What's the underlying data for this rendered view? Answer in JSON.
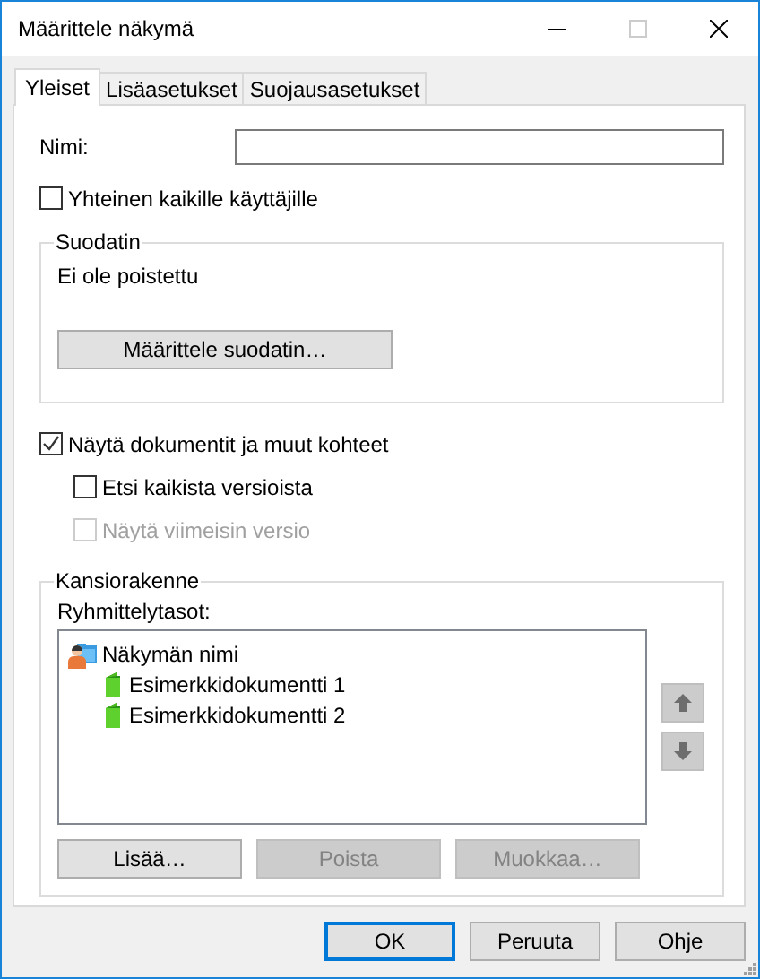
{
  "window": {
    "title": "Määrittele näkymä",
    "controls": [
      {
        "kind": "minimize",
        "disabled": false
      },
      {
        "kind": "maximize",
        "disabled": true
      },
      {
        "kind": "close",
        "disabled": false
      }
    ]
  },
  "tabs": [
    {
      "label": "Yleiset",
      "selected": true
    },
    {
      "label": "Lisäasetukset",
      "selected": false
    },
    {
      "label": "Suojausasetukset",
      "selected": false
    }
  ],
  "name_field": {
    "label": "Nimi:"
  },
  "shared_checkbox": {
    "label": "Yhteinen kaikille käyttäjille",
    "checked": false,
    "disabled": false
  },
  "filter_group": {
    "title": "Suodatin",
    "status": "Ei ole poistettu",
    "button": "Määrittele suodatin…"
  },
  "document_options": [
    {
      "label": "Näytä dokumentit ja muut kohteet",
      "checked": true,
      "disabled": false,
      "children": [
        {
          "label": "Etsi kaikista versioista",
          "checked": false,
          "disabled": false
        },
        {
          "label": "Näytä viimeisin versio",
          "checked": false,
          "disabled": true
        }
      ]
    }
  ],
  "folder_group": {
    "title": "Kansiorakenne",
    "list_label": "Ryhmittelytasot:",
    "tree": [
      {
        "label": "Näkymän nimi",
        "kind": "view",
        "children": [
          {
            "label": "Esimerkkidokumentti 1",
            "kind": "document"
          },
          {
            "label": "Esimerkkidokumentti 2",
            "kind": "document"
          }
        ]
      }
    ],
    "move_buttons": [
      {
        "kind": "up",
        "disabled": true
      },
      {
        "kind": "down",
        "disabled": true
      }
    ],
    "buttons": [
      {
        "label": "Lisää…",
        "disabled": false
      },
      {
        "label": "Poista",
        "disabled": true
      },
      {
        "label": "Muokkaa…",
        "disabled": true
      }
    ]
  },
  "footer_buttons": [
    {
      "label": "OK",
      "default": true
    },
    {
      "label": "Peruuta",
      "default": false
    },
    {
      "label": "Ohje",
      "default": false
    }
  ]
}
